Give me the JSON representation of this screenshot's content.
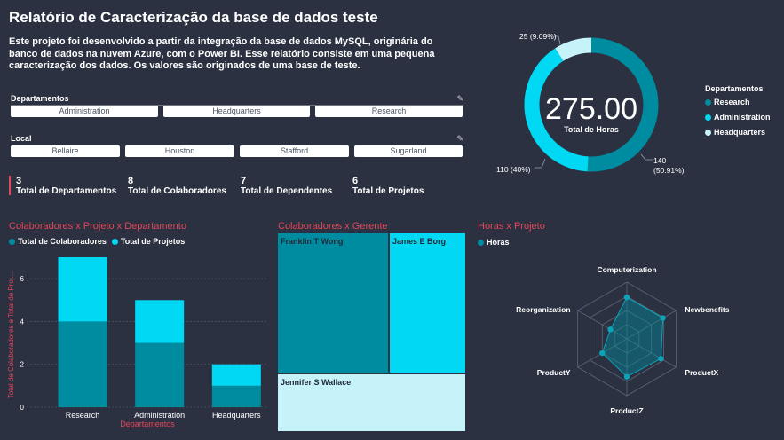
{
  "header": {
    "title": "Relatório de Caracterização da base de dados teste",
    "description": "Este projeto foi desenvolvido a partir da integração da base de dados MySQL, originária do banco de dados na nuvem Azure, com o Power BI. Esse relatório consiste em uma pequena caracterização dos dados. Os valores são originados de uma base de teste."
  },
  "slicers": {
    "departamentos": {
      "title": "Departamentos",
      "options": [
        "Administration",
        "Headquarters",
        "Research"
      ]
    },
    "local": {
      "title": "Local",
      "options": [
        "Bellaire",
        "Houston",
        "Stafford",
        "Sugarland"
      ]
    }
  },
  "kpis": [
    {
      "value": "3",
      "label": "Total de Departamentos"
    },
    {
      "value": "8",
      "label": "Total de Colaboradores"
    },
    {
      "value": "7",
      "label": "Total de Dependentes"
    },
    {
      "value": "6",
      "label": "Total de Projetos"
    }
  ],
  "colors": {
    "dark_teal": "#008ca0",
    "cyan": "#00d8f4",
    "light_cyan": "#c6f3fa",
    "accent_red": "#e4465b",
    "background": "#2b3140"
  },
  "donut": {
    "center_value": "275.00",
    "center_label": "Total de Horas",
    "legend_title": "Departamentos",
    "labels": {
      "headquarters": "25 (9.09%)",
      "administration": "110 (40%)",
      "research": "140",
      "research_pct": "(50.91%)"
    },
    "chart_data": {
      "type": "pie",
      "total": 275,
      "slices": [
        {
          "name": "Research",
          "value": 140,
          "percent": 50.91,
          "color": "#008ca0"
        },
        {
          "name": "Administration",
          "value": 110,
          "percent": 40.0,
          "color": "#00d8f4"
        },
        {
          "name": "Headquarters",
          "value": 25,
          "percent": 9.09,
          "color": "#c6f3fa"
        }
      ]
    }
  },
  "bar_section": {
    "title": "Colaboradores x Projeto x Departamento",
    "legend": [
      "Total de Colaboradores",
      "Total de Projetos"
    ],
    "xlabel": "Departamentos",
    "ylabel": "Total de Colaboradores e Total de Proj...",
    "chart_data": {
      "type": "bar",
      "stacked": true,
      "categories": [
        "Research",
        "Administration",
        "Headquarters"
      ],
      "series": [
        {
          "name": "Total de Colaboradores",
          "values": [
            4,
            3,
            1
          ],
          "color": "#008ca0"
        },
        {
          "name": "Total de Projetos",
          "values": [
            3,
            2,
            1
          ],
          "color": "#00d8f4"
        }
      ],
      "ylim": [
        0,
        7
      ],
      "yticks": [
        "0",
        "2",
        "4",
        "6"
      ],
      "grid": true
    }
  },
  "treemap": {
    "title": "Colaboradores x Gerente",
    "items": [
      {
        "name": "Franklin T Wong",
        "color": "#008ca0"
      },
      {
        "name": "James E Borg",
        "color": "#00d8f4"
      },
      {
        "name": "Jennifer S Wallace",
        "color": "#c6f3fa"
      }
    ]
  },
  "radar_section": {
    "title": "Horas x Projeto",
    "legend": "Horas",
    "chart_data": {
      "type": "radar",
      "categories": [
        "Computerization",
        "Newbenefits",
        "ProductX",
        "ProductZ",
        "ProductY",
        "Reorganization"
      ],
      "values": [
        55,
        55,
        52,
        50,
        37.5,
        25
      ],
      "rmax": 75,
      "rings": 4
    }
  }
}
